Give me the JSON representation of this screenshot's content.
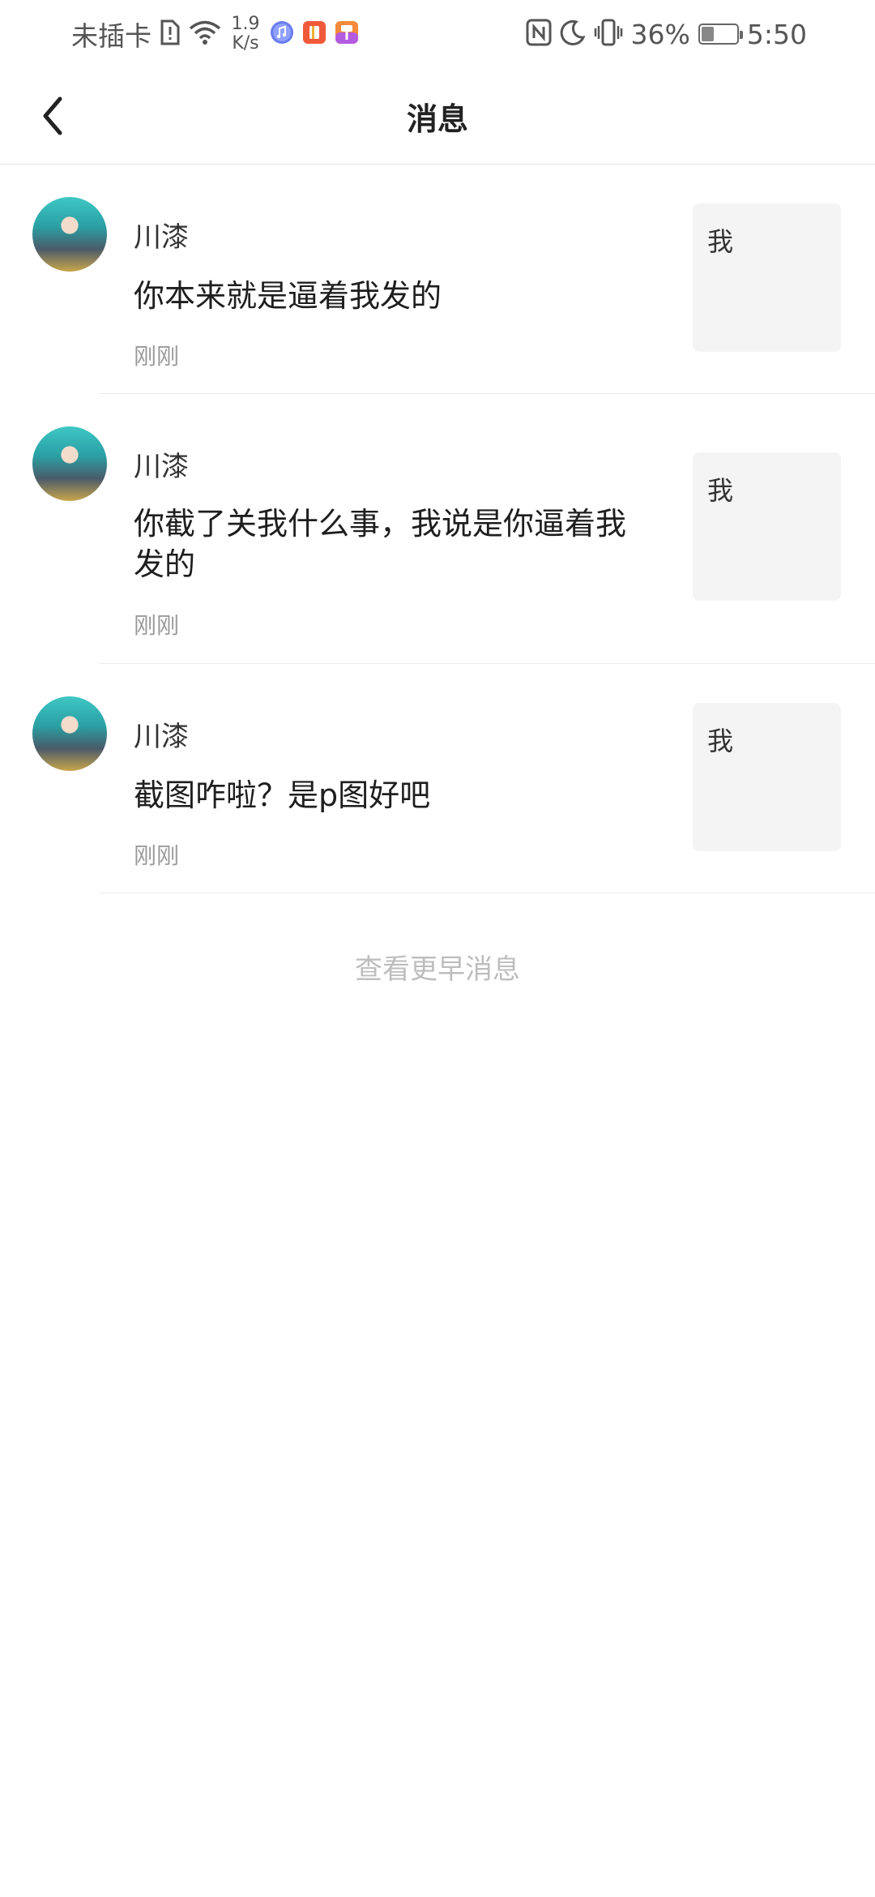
{
  "status_bar": {
    "carrier": "未插卡",
    "speed_value": "1.9",
    "speed_unit": "K/s",
    "battery_percent": 36,
    "battery_label": "36%",
    "time": "5:50"
  },
  "header": {
    "title": "消息"
  },
  "messages": [
    {
      "sender": "川漆",
      "text": "你本来就是逼着我发的",
      "time": "刚刚",
      "thumb_text": "我"
    },
    {
      "sender": "川漆",
      "text": "你截了关我什么事，我说是你逼着我发的",
      "time": "刚刚",
      "thumb_text": "我"
    },
    {
      "sender": "川漆",
      "text": "截图咋啦？是p图好吧",
      "time": "刚刚",
      "thumb_text": "我"
    }
  ],
  "footer": {
    "more_label": "查看更早消息"
  },
  "colors": {
    "accent_text": "#1e1e1e",
    "muted_text": "#9a9a9a",
    "thumb_bg": "#f4f4f4"
  }
}
